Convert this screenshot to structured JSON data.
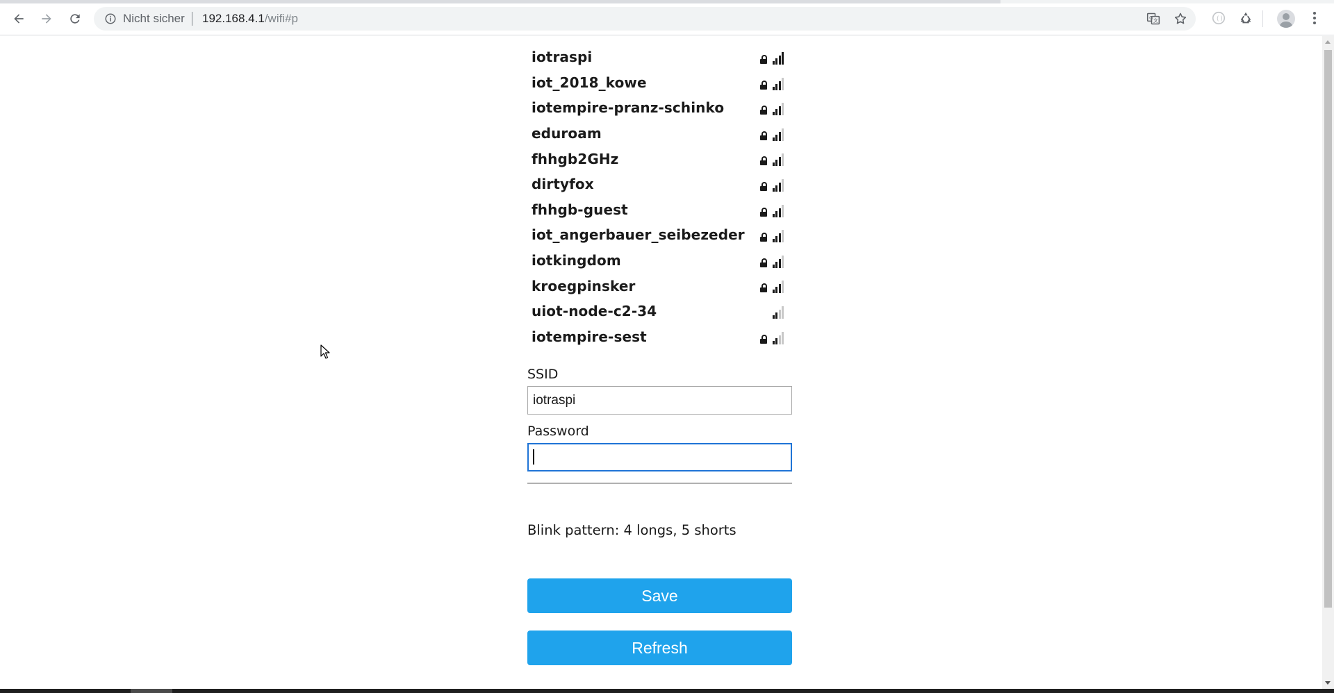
{
  "browser": {
    "security_label": "Nicht sicher",
    "url_host": "192.168.4.1",
    "url_path": "/wifi#p",
    "progress_fraction": 0.75
  },
  "networks": [
    {
      "ssid": "iotraspi",
      "locked": true,
      "signal_bars": 4
    },
    {
      "ssid": "iot_2018_kowe",
      "locked": true,
      "signal_bars": 3
    },
    {
      "ssid": "iotempire-pranz-schinko",
      "locked": true,
      "signal_bars": 3
    },
    {
      "ssid": "eduroam",
      "locked": true,
      "signal_bars": 3
    },
    {
      "ssid": "fhhgb2GHz",
      "locked": true,
      "signal_bars": 3
    },
    {
      "ssid": "dirtyfox",
      "locked": true,
      "signal_bars": 3
    },
    {
      "ssid": "fhhgb-guest",
      "locked": true,
      "signal_bars": 3
    },
    {
      "ssid": "iot_angerbauer_seibezeder",
      "locked": true,
      "signal_bars": 3
    },
    {
      "ssid": "iotkingdom",
      "locked": true,
      "signal_bars": 3
    },
    {
      "ssid": "kroegpinsker",
      "locked": true,
      "signal_bars": 3
    },
    {
      "ssid": "uiot-node-c2-34",
      "locked": false,
      "signal_bars": 2
    },
    {
      "ssid": "iotempire-sest",
      "locked": true,
      "signal_bars": 2
    }
  ],
  "form": {
    "ssid_label": "SSID",
    "ssid_value": "iotraspi",
    "password_label": "Password",
    "password_value": ""
  },
  "blink_pattern": "Blink pattern: 4 longs, 5 shorts",
  "buttons": {
    "save_label": "Save",
    "refresh_label": "Refresh"
  },
  "colors": {
    "button_bg": "#1fa3ec",
    "focus_border": "#1f74d6"
  }
}
